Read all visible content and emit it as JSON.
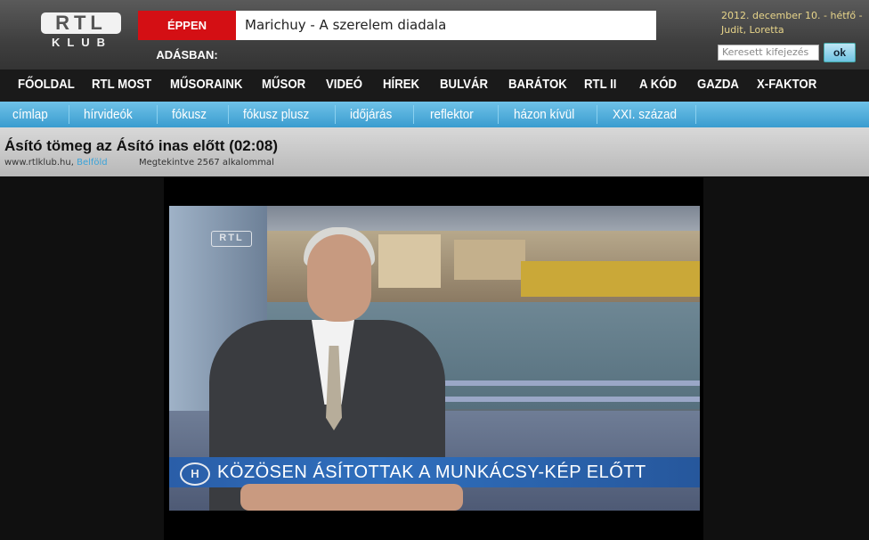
{
  "header": {
    "logo_top": "RTL",
    "logo_bottom": "KLUB",
    "live_label": "ÉPPEN ADÁSBAN:",
    "live_program": "Marichuy - A szerelem diadala",
    "date_line1": "2012. december 10. - hétfő -",
    "date_line2": "Judit, Loretta",
    "search_placeholder": "Keresett kifejezés",
    "search_button": "ok"
  },
  "main_nav": [
    "FŐOLDAL",
    "RTL MOST",
    "MŰSORAINK",
    "MŰSOR",
    "VIDEÓ",
    "HÍREK",
    "BULVÁR",
    "BARÁTOK",
    "RTL II",
    "A KÓD",
    "GAZDA",
    "X-FAKTOR"
  ],
  "sub_nav": [
    "címlap",
    "hírvideók",
    "fókusz",
    "fókusz plusz",
    "időjárás",
    "reflektor",
    "házon kívül",
    "XXI. század"
  ],
  "video": {
    "title": "Ásító tömeg az Ásító inas előtt (02:08)",
    "source": "www.rtlklub.hu,",
    "source_link": "Belföld",
    "views": "Megtekintve 2567 alkalommal",
    "caption": "KÖZÖSEN ÁSÍTOTTAK A MUNKÁCSY-KÉP ELŐTT",
    "channel_logo": "RTL",
    "badge": "H"
  },
  "colors": {
    "live_red": "#d40f14",
    "subnav_blue": "#3a9ccf",
    "date_gold": "#e8d58a",
    "link_blue": "#3aa3d9"
  }
}
